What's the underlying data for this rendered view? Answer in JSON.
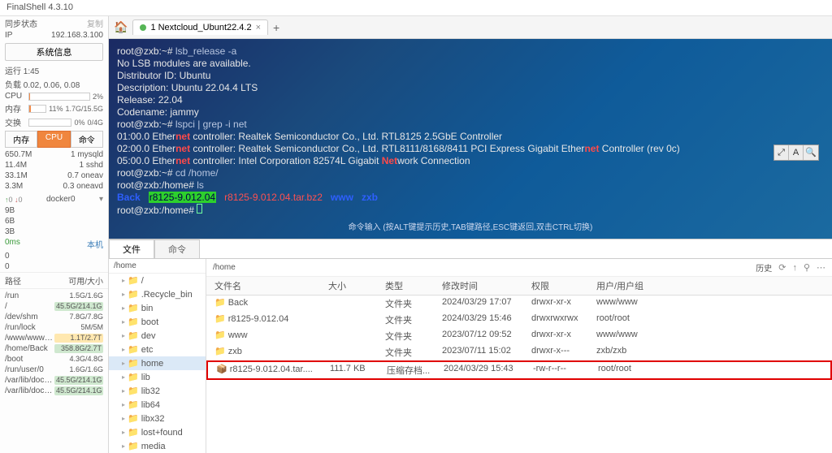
{
  "app": {
    "title": "FinalShell 4.3.10"
  },
  "sidebar": {
    "sync_label": "同步状态",
    "copy_label": "复制",
    "ip_label": "IP",
    "ip_value": "192.168.3.100",
    "sysinfo_btn": "系统信息",
    "runtime": "运行 1:45",
    "load": "负载 0.02, 0.06, 0.08",
    "cpu_label": "CPU",
    "cpu_pct": "2%",
    "mem_label": "内存",
    "mem_pct": "11%",
    "mem_txt": "1.7G/15.5G",
    "swap_label": "交换",
    "swap_pct": "0%",
    "swap_txt": "0/4G",
    "tabs": {
      "mem": "内存",
      "cpu": "CPU",
      "cmd": "命令"
    },
    "procs": [
      {
        "v": "650.7M",
        "n": "1 mysqld"
      },
      {
        "v": "11.4M",
        "n": "1 sshd"
      },
      {
        "v": "33.1M",
        "n": "0.7 oneav"
      },
      {
        "v": "3.3M",
        "n": "0.3 oneavd"
      }
    ],
    "net": {
      "up": "0",
      "dn": "0",
      "name": "docker0"
    },
    "net2": {
      "l1": "9B",
      "l2": "6B",
      "l3": "3B"
    },
    "ping": "0ms",
    "host": "本机",
    "z1": "0",
    "z2": "0",
    "disk_header": {
      "path": "路径",
      "size": "可用/大小"
    },
    "disks": [
      {
        "p": "/run",
        "s": "1.5G/1.6G"
      },
      {
        "p": "/",
        "s": "45.5G/214.1G",
        "cls": "warn"
      },
      {
        "p": "/dev/shm",
        "s": "7.8G/7.8G"
      },
      {
        "p": "/run/lock",
        "s": "5M/5M"
      },
      {
        "p": "/www/wwwro...",
        "s": "1.1T/2.7T",
        "cls": "warn2"
      },
      {
        "p": "/home/Back",
        "s": "358.8G/2.7T",
        "cls": "warn"
      },
      {
        "p": "/boot",
        "s": "4.3G/4.8G"
      },
      {
        "p": "/run/user/0",
        "s": "1.6G/1.6G"
      },
      {
        "p": "/var/lib/dock...",
        "s": "45.5G/214.1G",
        "cls": "warn"
      },
      {
        "p": "/var/lib/dock...",
        "s": "45.5G/214.1G",
        "cls": "warn"
      }
    ]
  },
  "tab": {
    "name": "1 Nextcloud_Ubunt22.4.2"
  },
  "terminal": {
    "l1a": "root@zxb:~# ",
    "l1b": "lsb_release -a",
    "l2": "No LSB modules are available.",
    "l3": "Distributor ID: Ubuntu",
    "l4": "Description:    Ubuntu 22.04.4 LTS",
    "l5": "Release:        22.04",
    "l6": "Codename:       jammy",
    "l7a": "root@zxb:~# ",
    "l7b": "lspci | grep -i net",
    "l8a": "01:00.0 Ether",
    "l8b": " controller: Realtek Semiconductor Co., Ltd. RTL8125 2.5GbE Controller",
    "l9a": "02:00.0 Ether",
    "l9b": " controller: Realtek Semiconductor Co., Ltd. RTL8111/8168/8411 PCI Express Gigabit Ether",
    "l9c": " Controller (rev 0c)",
    "l10a": " 05:00.0 Ether",
    "l10b": " controller: Intel Corporation 82574L Gigabit ",
    "l10c": "work Connection",
    "l11a": "root@zxb:~# ",
    "l11b": "cd /home/",
    "l12a": "root@zxb:/home# ",
    "l12b": "ls",
    "l13a": "Back",
    "l13b": "r8125-9.012.04",
    "l13c": "r8125-9.012.04.tar.bz2",
    "l13d": "www",
    "l13e": "zxb",
    "l14": "root@zxb:/home# ",
    "net": "net",
    "Net": "Net",
    "hint": "命令输入 (按ALT键提示历史,TAB键路径,ESC键返回,双击CTRL切换)"
  },
  "lower": {
    "tab_file": "文件",
    "tab_cmd": "命令",
    "tree_path": "/home",
    "tree": [
      "/",
      ".Recycle_bin",
      "bin",
      "boot",
      "dev",
      "etc",
      "home",
      "lib",
      "lib32",
      "lib64",
      "libx32",
      "lost+found",
      "media"
    ],
    "fp_path": "/home",
    "hist": "历史",
    "cols": {
      "name": "文件名",
      "size": "大小",
      "type": "类型",
      "mtime": "修改时间",
      "perm": "权限",
      "owner": "用户/用户组"
    },
    "rows": [
      {
        "n": "Back",
        "s": "",
        "t": "文件夹",
        "m": "2024/03/29 17:07",
        "p": "drwxr-xr-x",
        "o": "www/www",
        "icon": "fld"
      },
      {
        "n": "r8125-9.012.04",
        "s": "",
        "t": "文件夹",
        "m": "2024/03/29 15:46",
        "p": "drwxrwxrwx",
        "o": "root/root",
        "icon": "fld"
      },
      {
        "n": "www",
        "s": "",
        "t": "文件夹",
        "m": "2023/07/12 09:52",
        "p": "drwxr-xr-x",
        "o": "www/www",
        "icon": "fld"
      },
      {
        "n": "zxb",
        "s": "",
        "t": "文件夹",
        "m": "2023/07/11 15:02",
        "p": "drwxr-x---",
        "o": "zxb/zxb",
        "icon": "fld"
      },
      {
        "n": "r8125-9.012.04.tar....",
        "s": "111.7 KB",
        "t": "压缩存档...",
        "m": "2024/03/29 15:43",
        "p": "-rw-r--r--",
        "o": "root/root",
        "icon": "arc",
        "hl": true
      }
    ]
  }
}
